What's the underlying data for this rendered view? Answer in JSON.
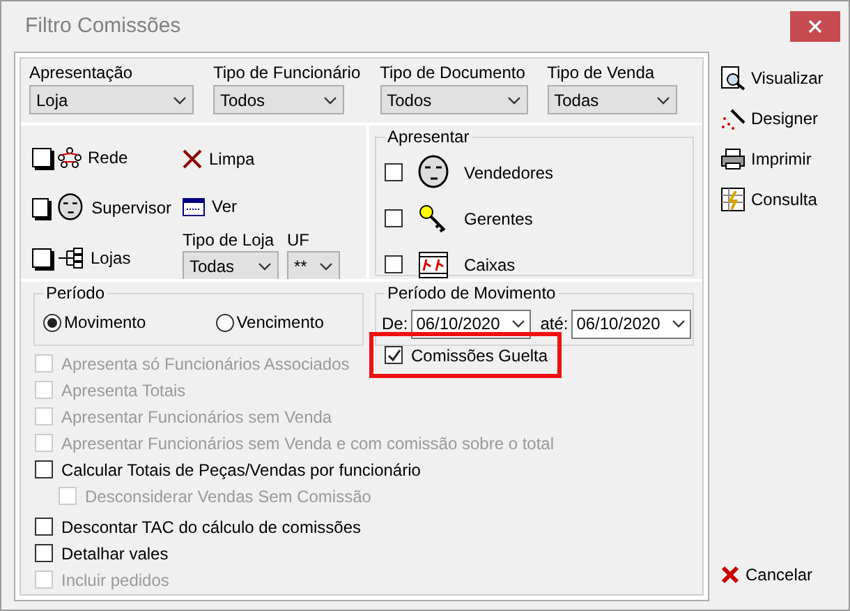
{
  "window": {
    "title": "Filtro Comissões"
  },
  "filters": [
    {
      "label": "Apresentação",
      "value": "Loja"
    },
    {
      "label": "Tipo de Funcionário",
      "value": "Todos"
    },
    {
      "label": "Tipo de Documento",
      "value": "Todos"
    },
    {
      "label": "Tipo de Venda",
      "value": "Todas"
    }
  ],
  "selectors": [
    {
      "kind": "network",
      "label": "Rede",
      "checked": false
    },
    {
      "kind": "person",
      "label": "Supervisor",
      "checked": false
    },
    {
      "kind": "tree",
      "label": "Lojas",
      "checked": false
    }
  ],
  "actions": [
    {
      "kind": "clear",
      "label": "Limpa"
    },
    {
      "kind": "view",
      "label": "Ver"
    }
  ],
  "tipo_loja": {
    "label": "Tipo de Loja",
    "value": "Todas"
  },
  "uf": {
    "label": "UF",
    "value": "**"
  },
  "apresentar": {
    "title": "Apresentar",
    "items": [
      {
        "kind": "person",
        "label": "Vendedores",
        "checked": false
      },
      {
        "kind": "key",
        "label": "Gerentes",
        "checked": false
      },
      {
        "kind": "film",
        "label": "Caixas",
        "checked": false
      }
    ]
  },
  "periodo": {
    "title": "Período",
    "options": [
      {
        "label": "Movimento",
        "selected": true
      },
      {
        "label": "Vencimento",
        "selected": false
      }
    ]
  },
  "periodo_movimento": {
    "title": "Período de Movimento",
    "from_label": "De:",
    "from": "06/10/2020",
    "to_label": "até:",
    "to": "06/10/2020"
  },
  "comissoes_guelta": {
    "label": "Comissões Guelta",
    "checked": true,
    "highlighted": true
  },
  "checks": [
    {
      "label": "Apresenta só Funcionários Associados",
      "checked": false,
      "disabled": true
    },
    {
      "label": "Apresenta Totais",
      "checked": false,
      "disabled": true
    },
    {
      "label": "Apresentar Funcionários sem Venda",
      "checked": false,
      "disabled": true
    },
    {
      "label": "Apresentar Funcionários sem Venda e com comissão sobre o total",
      "checked": false,
      "disabled": true
    },
    {
      "label": "Calcular Totais de Peças/Vendas por funcionário",
      "checked": false,
      "disabled": false,
      "children": [
        {
          "label": "Desconsiderar Vendas Sem Comissão",
          "checked": false,
          "disabled": true
        }
      ]
    },
    {
      "label": "Descontar TAC do cálculo de comissões",
      "checked": false,
      "disabled": false
    },
    {
      "label": "Detalhar vales",
      "checked": false,
      "disabled": false
    },
    {
      "label": "Incluir pedidos",
      "checked": false,
      "disabled": true
    }
  ],
  "buttons": [
    {
      "kind": "preview",
      "label": "Visualizar"
    },
    {
      "kind": "designer",
      "label": "Designer"
    },
    {
      "kind": "print",
      "label": "Imprimir"
    },
    {
      "kind": "query",
      "label": "Consulta"
    }
  ],
  "cancel": {
    "label": "Cancelar"
  }
}
